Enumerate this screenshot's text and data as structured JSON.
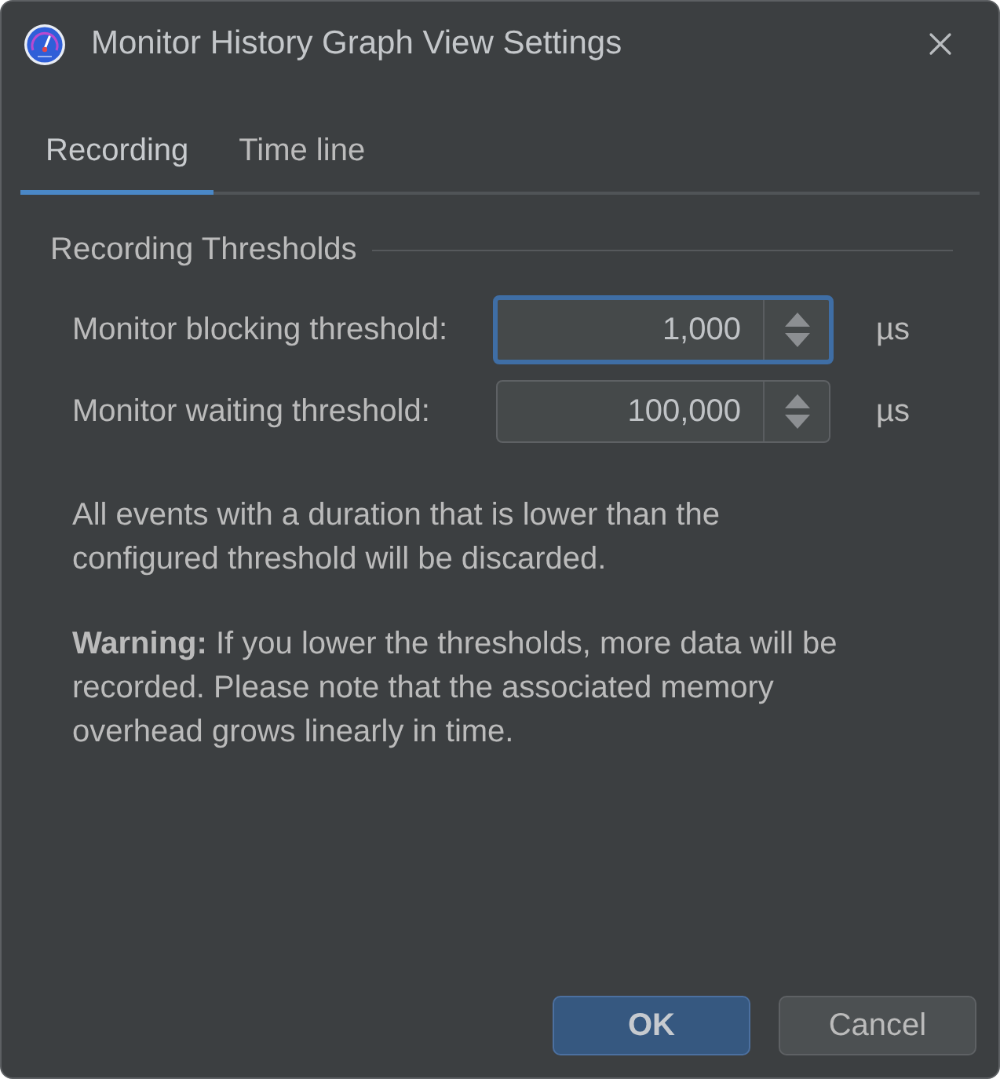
{
  "window": {
    "title": "Monitor History Graph View Settings"
  },
  "tabs": [
    {
      "label": "Recording",
      "selected": true
    },
    {
      "label": "Time line",
      "selected": false
    }
  ],
  "group": {
    "title": "Recording Thresholds",
    "fields": [
      {
        "label": "Monitor blocking threshold:",
        "value": "1,000",
        "unit": "µs",
        "focused": true
      },
      {
        "label": "Monitor waiting threshold:",
        "value": "100,000",
        "unit": "µs",
        "focused": false
      }
    ]
  },
  "paragraphs": [
    "All events with a duration that is lower than the configured threshold will be discarded.",
    "**Warning:** If you lower the thresholds, more data will be recorded. Please note that the associated memory overhead grows linearly in time."
  ],
  "buttons": [
    {
      "label": "OK",
      "default": true
    },
    {
      "label": "Cancel",
      "default": false
    }
  ]
}
